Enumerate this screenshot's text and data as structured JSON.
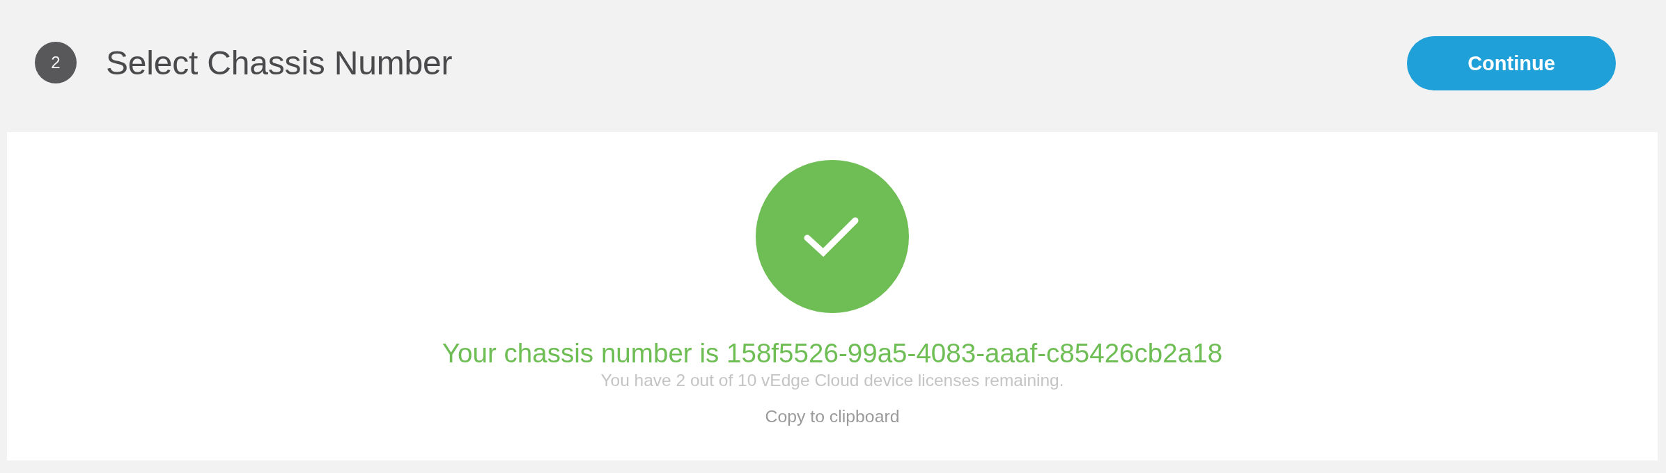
{
  "header": {
    "step": "2",
    "title": "Select Chassis Number",
    "continue_button": "Continue"
  },
  "result": {
    "kind": "success",
    "message": "Your chassis number is 158f5526-99a5-4083-aaaf-c85426cb2a18",
    "licenses": "You have 2 out of 10 vEdge Cloud device licenses remaining.",
    "copy_link": "Copy to clipboard"
  }
}
